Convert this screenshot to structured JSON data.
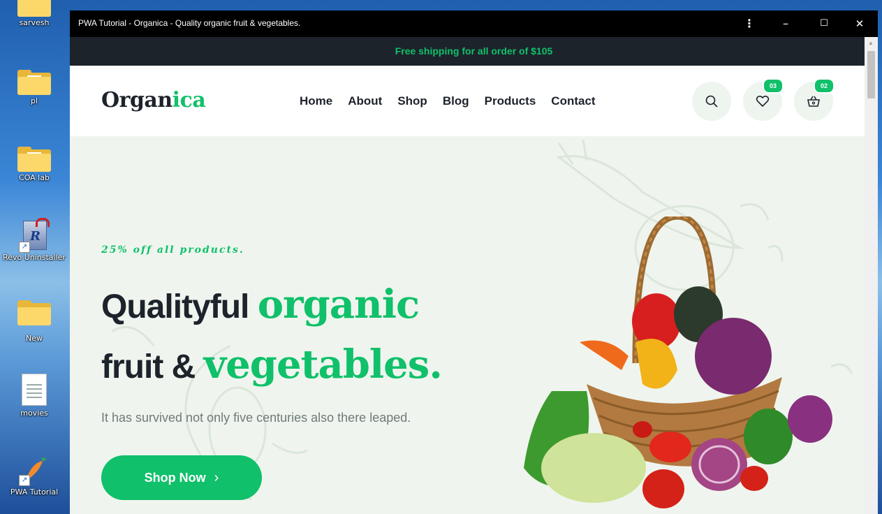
{
  "desktop": {
    "icons": [
      {
        "label": "sarvesh",
        "type": "folder"
      },
      {
        "label": "pl",
        "type": "folder"
      },
      {
        "label": "COA lab",
        "type": "folder"
      },
      {
        "label": "Revo Uninstaller",
        "type": "app-shortcut"
      },
      {
        "label": "New",
        "type": "folder"
      },
      {
        "label": "movies",
        "type": "document"
      },
      {
        "label": "PWA Tutorial",
        "type": "app-shortcut"
      }
    ]
  },
  "window": {
    "title": "PWA Tutorial - Organica - Quality organic fruit & vegetables.",
    "controls": {
      "menu": "⋮",
      "minimize": "–",
      "maximize": "☐",
      "close": "✕"
    }
  },
  "topbar": {
    "text": "Free shipping for all order of $105"
  },
  "header": {
    "logo_main": "Organ",
    "logo_accent": "ica",
    "nav": [
      "Home",
      "About",
      "Shop",
      "Blog",
      "Products",
      "Contact"
    ],
    "wishlist_count": "03",
    "cart_count": "02"
  },
  "hero": {
    "promo": "25% off all products.",
    "heading_line1_dark": "Qualityful ",
    "heading_line1_green": "organic",
    "heading_line2_dark": "fruit & ",
    "heading_line2_green": "vegetables.",
    "subtitle": "It has survived not only five centuries also there leaped.",
    "button_label": "Shop Now",
    "button_icon": "›"
  },
  "colors": {
    "accent": "#10c06a",
    "dark": "#1d232b",
    "hero_bg": "#eff5ee"
  }
}
